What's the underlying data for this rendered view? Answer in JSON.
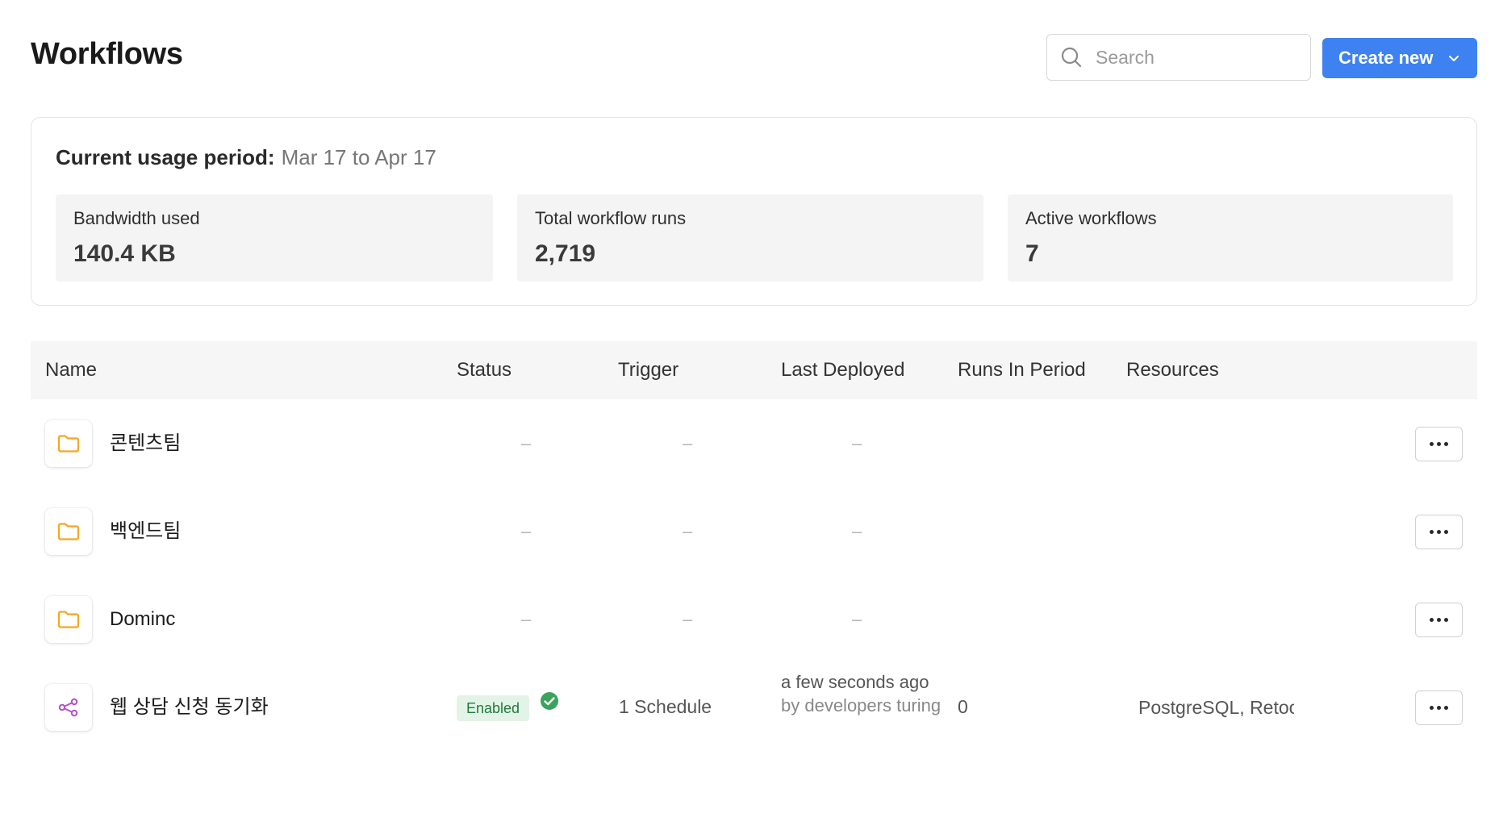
{
  "page": {
    "title": "Workflows"
  },
  "search": {
    "placeholder": "Search",
    "icon": "search-icon"
  },
  "create_button": {
    "label": "Create new",
    "icon": "chevron-down-icon",
    "color": "#3d82f0"
  },
  "usage": {
    "heading_label": "Current usage period:",
    "period": "Mar 17 to Apr 17",
    "stats": [
      {
        "label": "Bandwidth used",
        "value": "140.4 KB"
      },
      {
        "label": "Total workflow runs",
        "value": "2,719"
      },
      {
        "label": "Active workflows",
        "value": "7"
      }
    ]
  },
  "table": {
    "columns": [
      "Name",
      "Status",
      "Trigger",
      "Last Deployed",
      "Runs In Period",
      "Resources"
    ],
    "rows": [
      {
        "icon": "folder-icon",
        "name": "콘텐츠팀",
        "status": "–",
        "trigger": "–",
        "last_deployed": "–"
      },
      {
        "icon": "folder-icon",
        "name": "백엔드팀",
        "status": "–",
        "trigger": "–",
        "last_deployed": "–"
      },
      {
        "icon": "folder-icon",
        "name": "Dominc",
        "status": "–",
        "trigger": "–",
        "last_deployed": "–"
      },
      {
        "icon": "workflow-icon",
        "name": "웹 상담 신청 동기화",
        "status": "Enabled",
        "status_icon": "check-circle-icon",
        "trigger": "1 Schedule",
        "last_deployed_when": "a few seconds ago",
        "last_deployed_by": "by developers turing",
        "runs": "0",
        "resources": "PostgreSQL, Retool"
      }
    ],
    "row_action_icon": "more-horizontal-icon"
  },
  "colors": {
    "accent": "#3d82f0",
    "folder": "#f5a623",
    "workflow": "#b54fcf",
    "enabled_bg": "#e3f3e7",
    "enabled_text": "#1f7a3d",
    "check": "#3aa35c"
  }
}
